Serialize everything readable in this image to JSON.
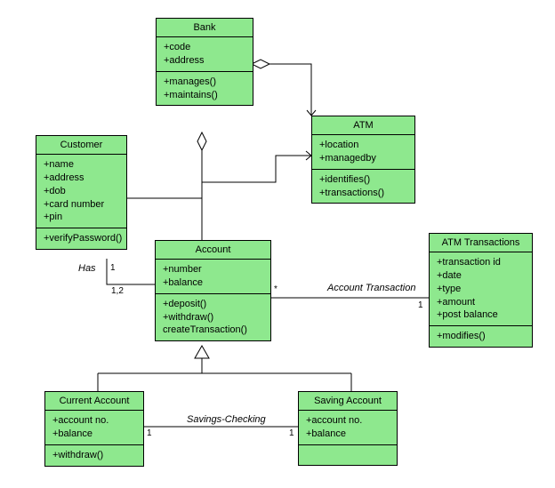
{
  "classes": {
    "bank": {
      "name": "Bank",
      "attributes": [
        "+code",
        "+address"
      ],
      "operations": [
        "+manages()",
        "+maintains()"
      ]
    },
    "customer": {
      "name": "Customer",
      "attributes": [
        "+name",
        "+address",
        "+dob",
        "+card number",
        "+pin"
      ],
      "operations": [
        "+verifyPassword()"
      ]
    },
    "atm": {
      "name": "ATM",
      "attributes": [
        "+location",
        "+managedby"
      ],
      "operations": [
        "+identifies()",
        "+transactions()"
      ]
    },
    "account": {
      "name": "Account",
      "attributes": [
        "+number",
        "+balance"
      ],
      "operations": [
        "+deposit()",
        "+withdraw()",
        "createTransaction()"
      ]
    },
    "atm_transactions": {
      "name": "ATM Transactions",
      "attributes": [
        "+transaction id",
        "+date",
        "+type",
        "+amount",
        "+post balance"
      ],
      "operations": [
        "+modifies()"
      ]
    },
    "current_account": {
      "name": "Current Account",
      "attributes": [
        "+account no.",
        "+balance"
      ],
      "operations": [
        "+withdraw()"
      ]
    },
    "saving_account": {
      "name": "Saving Account",
      "attributes": [
        "+account no.",
        "+balance"
      ]
    }
  },
  "associations": {
    "has": {
      "label": "Has",
      "mults": [
        "1",
        "1,2"
      ]
    },
    "account_transaction": {
      "label": "Account Transaction",
      "mults": [
        "*",
        "1"
      ]
    },
    "savings_checking": {
      "label": "Savings-Checking",
      "mults": [
        "1",
        "1"
      ]
    }
  },
  "colors": {
    "class_fill": "#8ee88e",
    "line": "#000000"
  }
}
